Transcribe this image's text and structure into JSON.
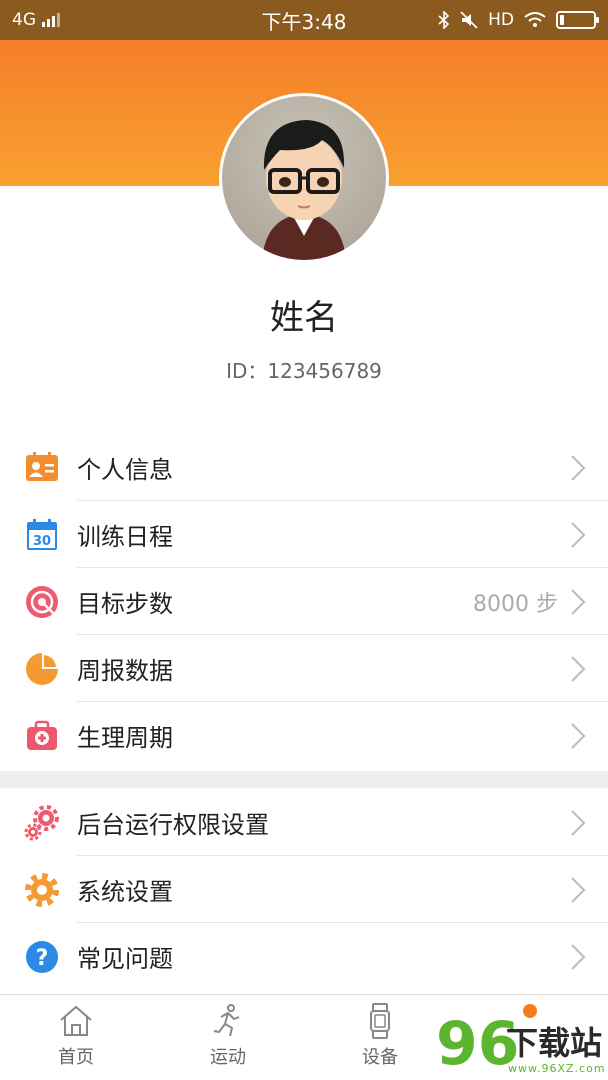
{
  "status_bar": {
    "network": "4G",
    "time": "下午3:48",
    "hd": "HD"
  },
  "profile": {
    "name": "姓名",
    "id_text": "ID：123456789"
  },
  "menu_group_1": [
    {
      "label": "个人信息",
      "icon": "id-card-icon",
      "color": "#f18c2f"
    },
    {
      "label": "训练日程",
      "icon": "calendar-icon",
      "color": "#2a8ae6",
      "icon_text": "30"
    },
    {
      "label": "目标步数",
      "icon": "target-icon",
      "color": "#ee5a6f",
      "value": "8000 步"
    },
    {
      "label": "周报数据",
      "icon": "pie-chart-icon",
      "color": "#f49a30"
    },
    {
      "label": "生理周期",
      "icon": "medical-kit-icon",
      "color": "#f0576f"
    }
  ],
  "menu_group_2": [
    {
      "label": "后台运行权限设置",
      "icon": "gears-icon",
      "color": "#ee5a6f"
    },
    {
      "label": "系统设置",
      "icon": "gear-icon",
      "color": "#f49a30"
    },
    {
      "label": "常见问题",
      "icon": "question-icon",
      "color": "#2a8ae6",
      "icon_text": "?"
    }
  ],
  "tabbar": [
    {
      "label": "首页",
      "icon": "home-icon"
    },
    {
      "label": "运动",
      "icon": "runner-icon"
    },
    {
      "label": "设备",
      "icon": "watch-icon"
    }
  ],
  "watermark": {
    "number": "96",
    "title": "下载站",
    "url": "www.96XZ.com"
  }
}
